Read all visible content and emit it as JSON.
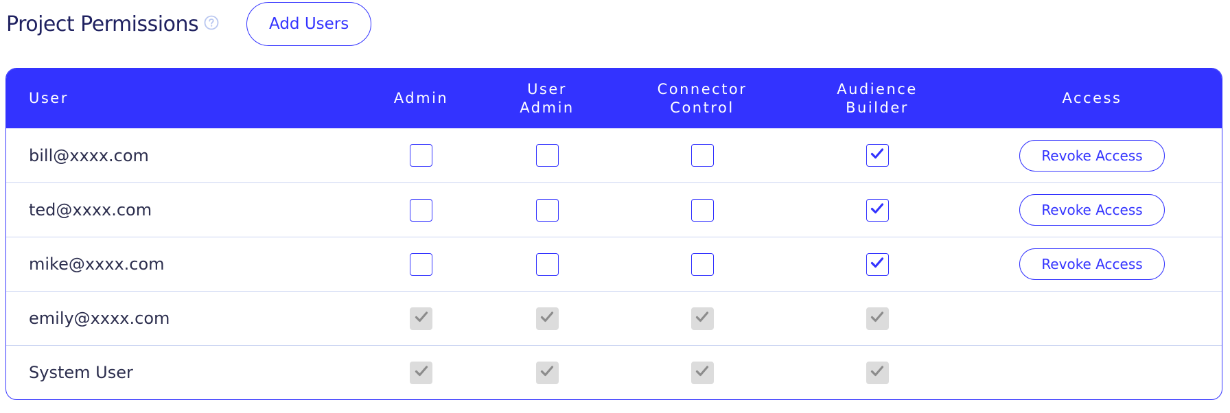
{
  "header": {
    "title": "Project Permissions",
    "help_icon": "question-circle-icon",
    "add_users_label": "Add Users"
  },
  "colors": {
    "accent": "#3333ff",
    "header_text": "#ffffff",
    "row_divider": "#c9d3f2",
    "disabled_checkbox": "#dcdcdc",
    "disabled_check": "#8c8c8c",
    "help_icon": "#b8c6f0"
  },
  "table": {
    "columns": [
      "User",
      "Admin",
      "User\nAdmin",
      "Connector\nControl",
      "Audience\nBuilder",
      "Access"
    ],
    "rows": [
      {
        "user": "bill@xxxx.com",
        "admin": "unchecked",
        "user_admin": "unchecked",
        "connector_control": "unchecked",
        "audience_builder": "checked",
        "access": "Revoke Access"
      },
      {
        "user": "ted@xxxx.com",
        "admin": "unchecked",
        "user_admin": "unchecked",
        "connector_control": "unchecked",
        "audience_builder": "checked",
        "access": "Revoke Access"
      },
      {
        "user": "mike@xxxx.com",
        "admin": "unchecked",
        "user_admin": "unchecked",
        "connector_control": "unchecked",
        "audience_builder": "checked",
        "access": "Revoke Access"
      },
      {
        "user": "emily@xxxx.com",
        "admin": "disabled-checked",
        "user_admin": "disabled-checked",
        "connector_control": "disabled-checked",
        "audience_builder": "disabled-checked",
        "access": ""
      },
      {
        "user": "System User",
        "admin": "disabled-checked",
        "user_admin": "disabled-checked",
        "connector_control": "disabled-checked",
        "audience_builder": "disabled-checked",
        "access": ""
      }
    ]
  }
}
